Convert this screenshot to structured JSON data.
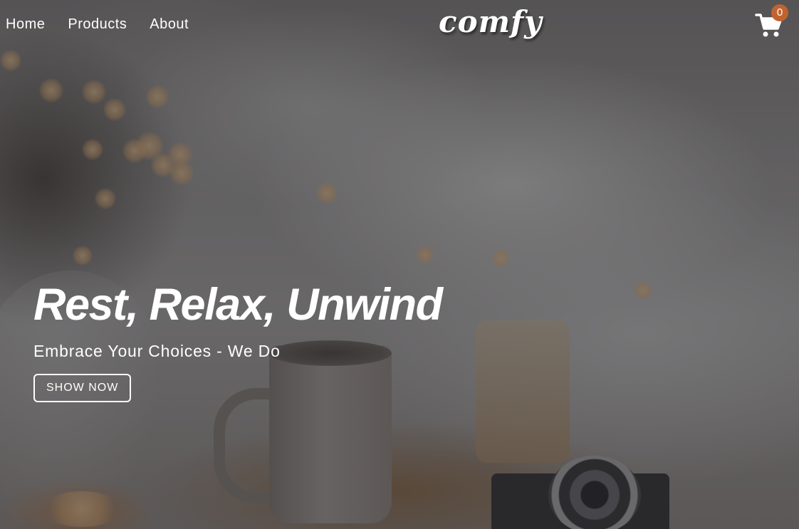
{
  "navbar": {
    "links": [
      "Home",
      "Products",
      "About"
    ],
    "logo": "comfy",
    "cart": {
      "icon": "shopping-cart-icon",
      "count": "0"
    }
  },
  "hero": {
    "title": "Rest, Relax, Unwind",
    "subtitle": "Embrace Your Choices - We Do",
    "button_label": "SHOW NOW"
  },
  "colors": {
    "badge": "#c0632f",
    "text": "#ffffff",
    "overlay": "#28282c"
  }
}
